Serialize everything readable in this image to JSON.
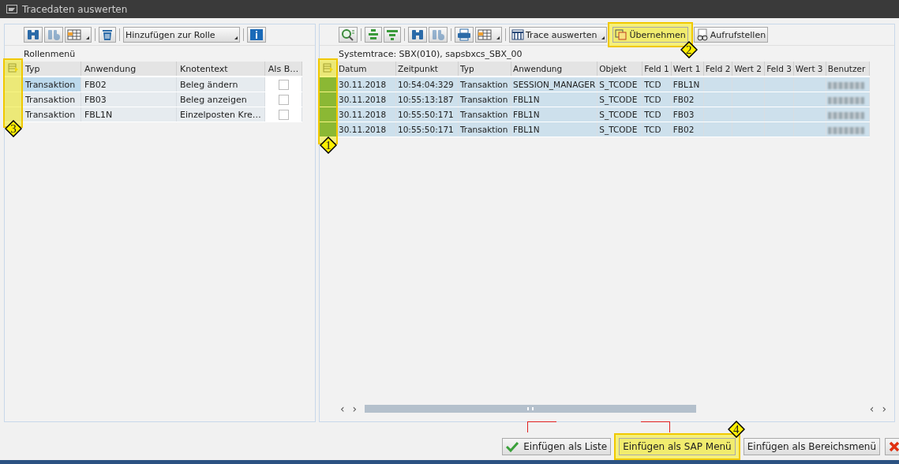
{
  "window": {
    "title": "Tracedaten auswerten"
  },
  "left_pane": {
    "toolbar": [
      {
        "kind": "icon",
        "disabled": false
      },
      {
        "kind": "icon",
        "disabled": true
      },
      {
        "kind": "menu-icon",
        "disabled": false
      },
      {
        "kind": "icon",
        "disabled": false
      },
      {
        "kind": "dropdown",
        "label": "Hinzufügen zur Rolle"
      },
      {
        "kind": "icon",
        "disabled": false
      }
    ],
    "title": "Rollenmenü",
    "callout": "3",
    "columns": [
      "Typ",
      "Anwendung",
      "Knotentext",
      "Als B…"
    ],
    "rows": [
      {
        "typ": "Transaktion",
        "anwendung": "FB02",
        "knotentext": "Beleg ändern",
        "checked": false,
        "focused": true
      },
      {
        "typ": "Transaktion",
        "anwendung": "FB03",
        "knotentext": "Beleg anzeigen",
        "checked": false,
        "focused": false
      },
      {
        "typ": "Transaktion",
        "anwendung": "FBL1N",
        "knotentext": "Einzelposten Kre…",
        "checked": false,
        "focused": false
      }
    ]
  },
  "right_pane": {
    "toolbar": [
      {
        "kind": "icon",
        "disabled": false
      },
      {
        "kind": "icon",
        "disabled": false
      },
      {
        "kind": "icon",
        "disabled": false
      },
      {
        "kind": "icon",
        "disabled": false
      },
      {
        "kind": "icon",
        "disabled": true
      },
      {
        "kind": "icon",
        "disabled": false
      },
      {
        "kind": "menu-icon",
        "disabled": false
      },
      {
        "kind": "dropdown",
        "label": "Trace auswerten"
      },
      {
        "kind": "button",
        "label": "Übernehmen",
        "callout": "2"
      },
      {
        "kind": "button",
        "label": "Aufrufstellen"
      }
    ],
    "title": "Systemtrace: SBX(010), sapsbxcs_SBX_00",
    "callout": "1",
    "columns": [
      "Datum",
      "Zeitpunkt",
      "Typ",
      "Anwendung",
      "Objekt",
      "Feld 1",
      "Wert 1",
      "Feld 2",
      "Wert 2",
      "Feld 3",
      "Wert 3",
      "Benutzer"
    ],
    "rows": [
      {
        "cells": [
          "30.11.2018",
          "10:54:04:329",
          "Transaktion",
          "SESSION_MANAGER",
          "S_TCODE",
          "TCD",
          "FBL1N"
        ],
        "selected": true
      },
      {
        "cells": [
          "30.11.2018",
          "10:55:13:187",
          "Transaktion",
          "FBL1N",
          "S_TCODE",
          "TCD",
          "FB02"
        ],
        "selected": true
      },
      {
        "cells": [
          "30.11.2018",
          "10:55:50:171",
          "Transaktion",
          "FBL1N",
          "S_TCODE",
          "TCD",
          "FB03"
        ],
        "selected": true
      },
      {
        "cells": [
          "30.11.2018",
          "10:55:50:171",
          "Transaktion",
          "FBL1N",
          "S_TCODE",
          "TCD",
          "FB02"
        ],
        "selected": true
      }
    ],
    "scroll_arrows": {
      "left": [
        "‹",
        "›"
      ],
      "right": [
        "‹",
        "›"
      ]
    }
  },
  "buttons": [
    {
      "kind": "confirm",
      "label": "Einfügen als Liste"
    },
    {
      "kind": "plain",
      "label": "Einfügen als SAP Menü",
      "callout": "4"
    },
    {
      "kind": "plain",
      "label": "Einfügen als Bereichsmenü"
    },
    {
      "kind": "cancel"
    }
  ]
}
